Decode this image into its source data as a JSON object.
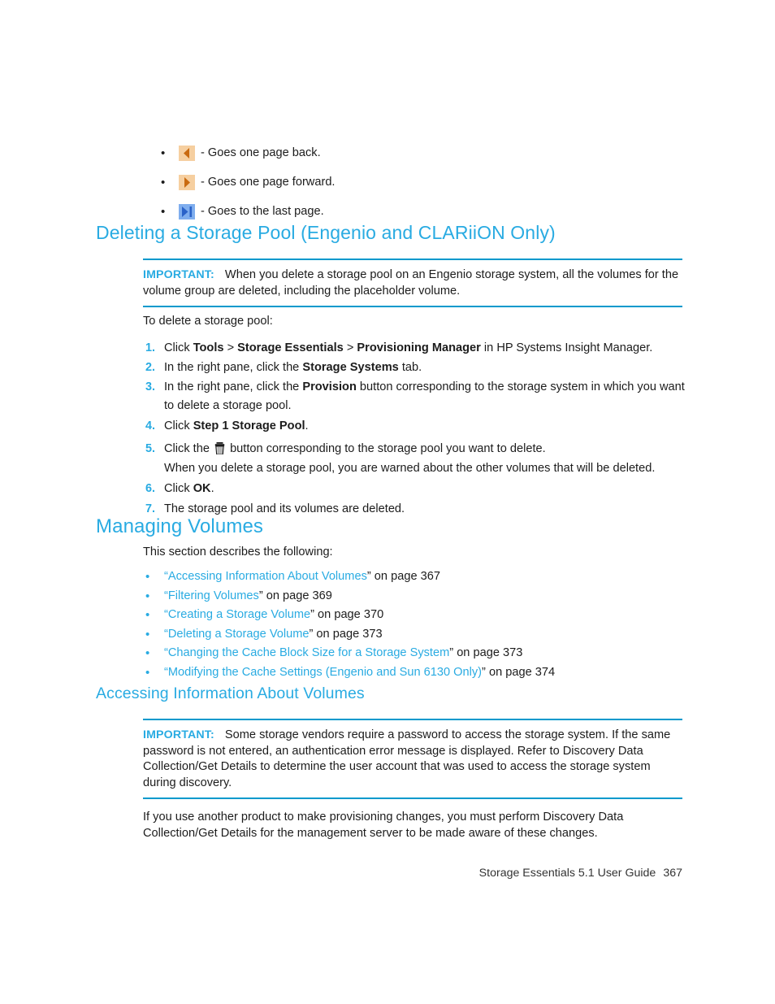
{
  "icon_legend": [
    {
      "icon": "previous-page-arrow-icon",
      "caption": "- Goes one page back."
    },
    {
      "icon": "next-page-arrow-icon",
      "caption": "- Goes one page forward."
    },
    {
      "icon": "last-page-arrow-icon",
      "caption": "- Goes to the last page."
    }
  ],
  "section_delete_pool": {
    "heading": "Deleting a Storage Pool (Engenio and CLARiiON Only)",
    "note": {
      "label": "IMPORTANT:",
      "text": "When you delete a storage pool on an Engenio storage system, all the volumes for the volume group are deleted, including the placeholder volume."
    },
    "intro": "To delete a storage pool:",
    "steps": [
      {
        "num": "1.",
        "pre": "Click ",
        "b1": "Tools",
        "mid1": " > ",
        "b2": "Storage Essentials",
        "mid2": " > ",
        "b3": "Provisioning Manager",
        "post": " in HP Systems Insight Manager."
      },
      {
        "num": "2.",
        "pre": "In the right pane, click the ",
        "b1": "Storage Systems",
        "post": " tab."
      },
      {
        "num": "3.",
        "pre": "In the right pane, click the ",
        "b1": "Provision",
        "post": " button corresponding to the storage system in which you want to delete a storage pool."
      },
      {
        "num": "4.",
        "pre": "Click ",
        "b1": "Step 1 Storage Pool",
        "post": "."
      },
      {
        "num": "5.",
        "pre": "Click the ",
        "icon": "trash-can-icon",
        "post": " button corresponding to the storage pool you want to delete.",
        "sub": "When you delete a storage pool, you are warned about the other volumes that will be deleted."
      },
      {
        "num": "6.",
        "pre": "Click ",
        "b1": "OK",
        "post": "."
      },
      {
        "num": "7.",
        "pre": "The storage pool and its volumes are deleted."
      }
    ]
  },
  "section_managing_volumes": {
    "heading": "Managing Volumes",
    "intro": "This section describes the following:",
    "links": [
      {
        "bullet": "•",
        "open": "“",
        "title": "Accessing Information About Volumes",
        "close": "”",
        "tail": " on page 367"
      },
      {
        "bullet": "•",
        "open": "“",
        "title": "Filtering Volumes",
        "close": "”",
        "tail": " on page 369"
      },
      {
        "bullet": "•",
        "open": "“",
        "title": "Creating a Storage Volume",
        "close": "”",
        "tail": " on page 370"
      },
      {
        "bullet": "•",
        "open": "“",
        "title": "Deleting a Storage Volume",
        "close": "”",
        "tail": " on page 373"
      },
      {
        "bullet": "•",
        "open": "“",
        "title": "Changing the Cache Block Size for a Storage System",
        "close": "”",
        "tail": " on page 373"
      },
      {
        "bullet": "•",
        "open": "“",
        "title": "Modifying the Cache Settings (Engenio and Sun 6130 Only)",
        "close": "”",
        "tail": " on page 374"
      }
    ]
  },
  "section_accessing_info": {
    "heading": "Accessing Information About Volumes",
    "note": {
      "label": "IMPORTANT:",
      "text": "Some storage vendors require a password to access the storage system. If the same password is not entered, an authentication error message is displayed. Refer to Discovery Data Collection/Get Details to determine the user account that was used to access the storage system during discovery."
    },
    "paragraph": "If you use another product to make provisioning changes, you must perform Discovery Data Collection/Get Details for the management server to be made aware of these changes."
  },
  "footer": {
    "guide": "Storage Essentials 5.1 User Guide",
    "page": "367"
  },
  "colors": {
    "heading_blue": "#29ABE2",
    "rule_blue": "#0099CC",
    "text_black": "#1c1c1c",
    "icon_peach": "#F6CFA0",
    "icon_orange": "#C96A10",
    "icon_light_blue": "#7FAEEE",
    "icon_dark_blue": "#2A62C8"
  }
}
